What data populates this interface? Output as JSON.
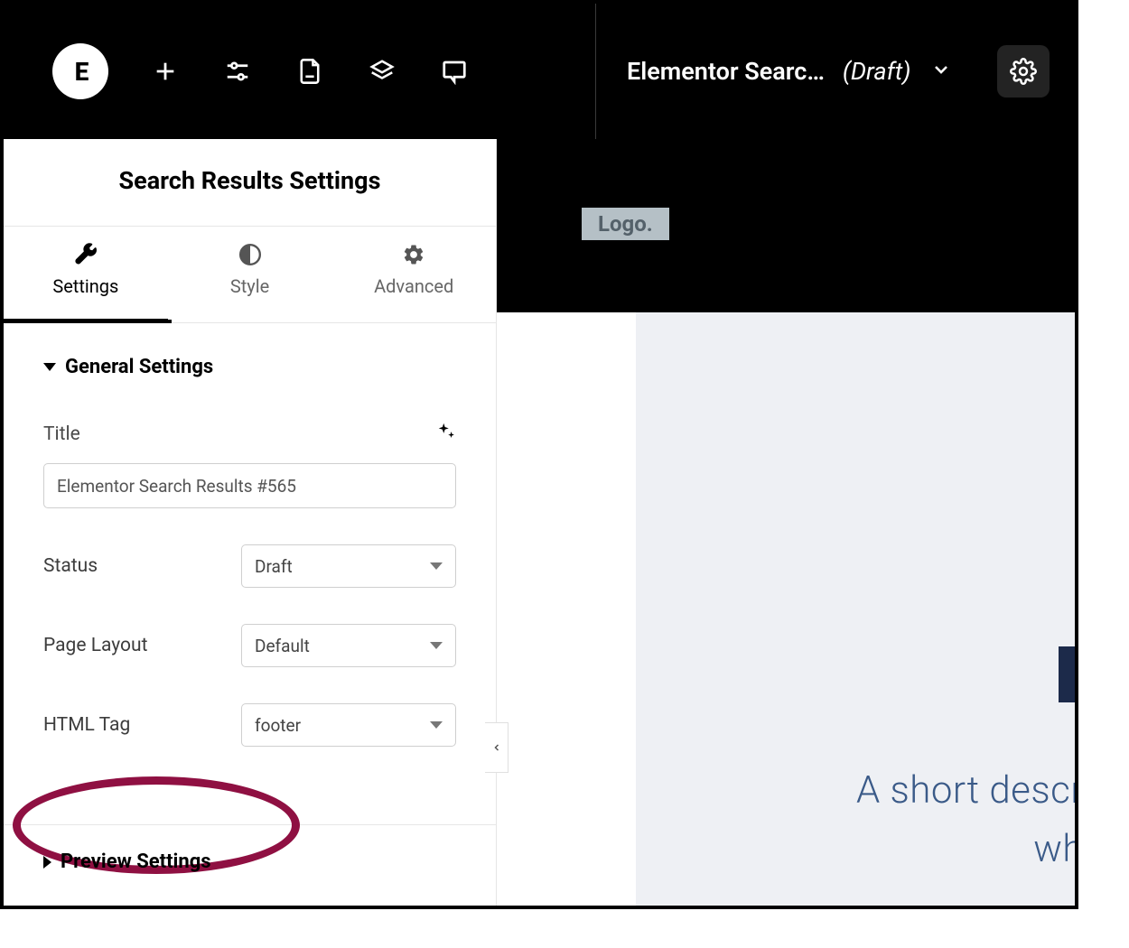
{
  "topbar": {
    "logo_text": "E",
    "doc_title": "Elementor Searc…",
    "doc_status": "(Draft)"
  },
  "panel": {
    "title": "Search Results Settings",
    "tabs": {
      "settings": "Settings",
      "style": "Style",
      "advanced": "Advanced"
    }
  },
  "sections": {
    "general": {
      "header": "General Settings",
      "title_label": "Title",
      "title_value": "Elementor Search Results #565",
      "status_label": "Status",
      "status_value": "Draft",
      "layout_label": "Page Layout",
      "layout_value": "Default",
      "htmltag_label": "HTML Tag",
      "htmltag_value": "footer"
    },
    "preview": {
      "header": "Preview Settings"
    }
  },
  "canvas": {
    "logo_chip": "Logo.",
    "hero_line1": "A short descr",
    "hero_line2": "wh"
  }
}
